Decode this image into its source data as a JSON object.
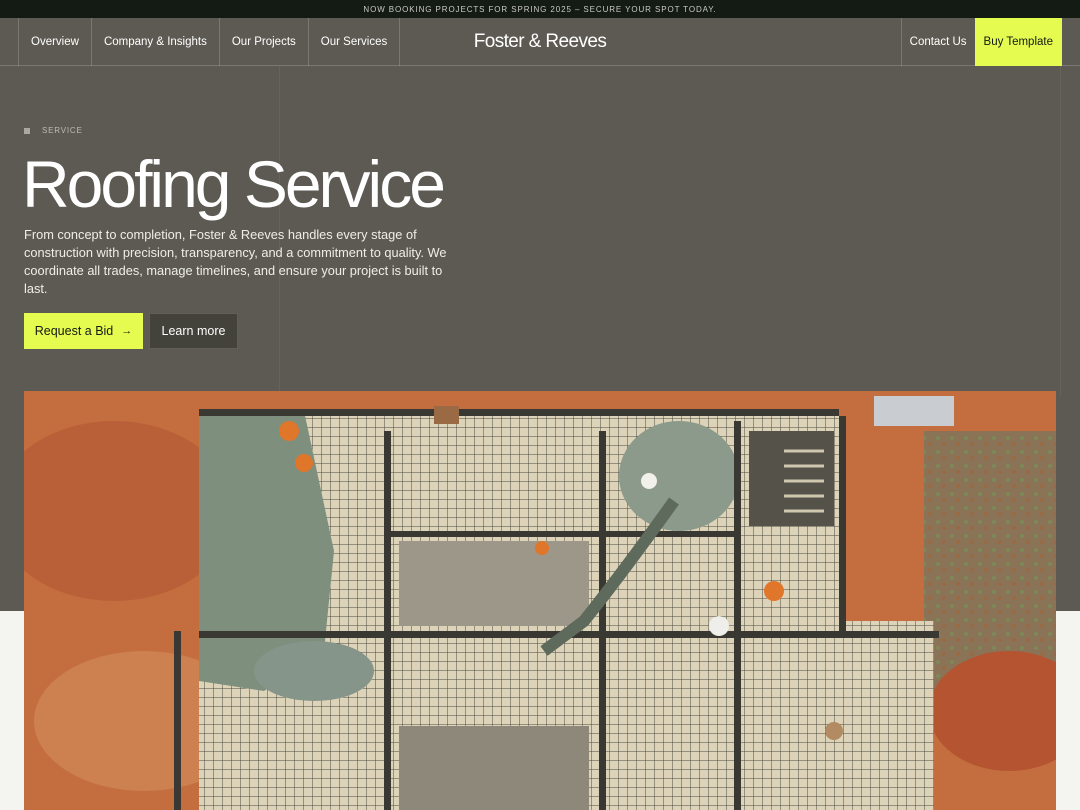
{
  "announcement": "NOW BOOKING PROJECTS FOR SPRING 2025 – SECURE YOUR SPOT TODAY.",
  "nav": {
    "items": [
      "Overview",
      "Company & Insights",
      "Our Projects",
      "Our Services"
    ],
    "brand": "Foster & Reeves",
    "contact": "Contact Us",
    "buy": "Buy Template"
  },
  "hero": {
    "tag": "SERVICE",
    "title": "Roofing Service",
    "description": "From concept to completion, Foster & Reeves handles every stage of construction with precision, transparency, and a commitment to quality. We coordinate all trades, manage timelines, and ensure your project is built to last.",
    "primary_button": "Request a Bid",
    "secondary_button": "Learn more"
  },
  "colors": {
    "accent": "#e6fb4f",
    "hero_bg": "#5c5a52",
    "dark": "#141a14",
    "light_bg": "#f4f4f1"
  },
  "icons": {
    "primary_arrow": "arrow-right-icon",
    "tag_marker": "square-icon"
  },
  "image": {
    "subject": "construction-site-aerial-photo"
  }
}
